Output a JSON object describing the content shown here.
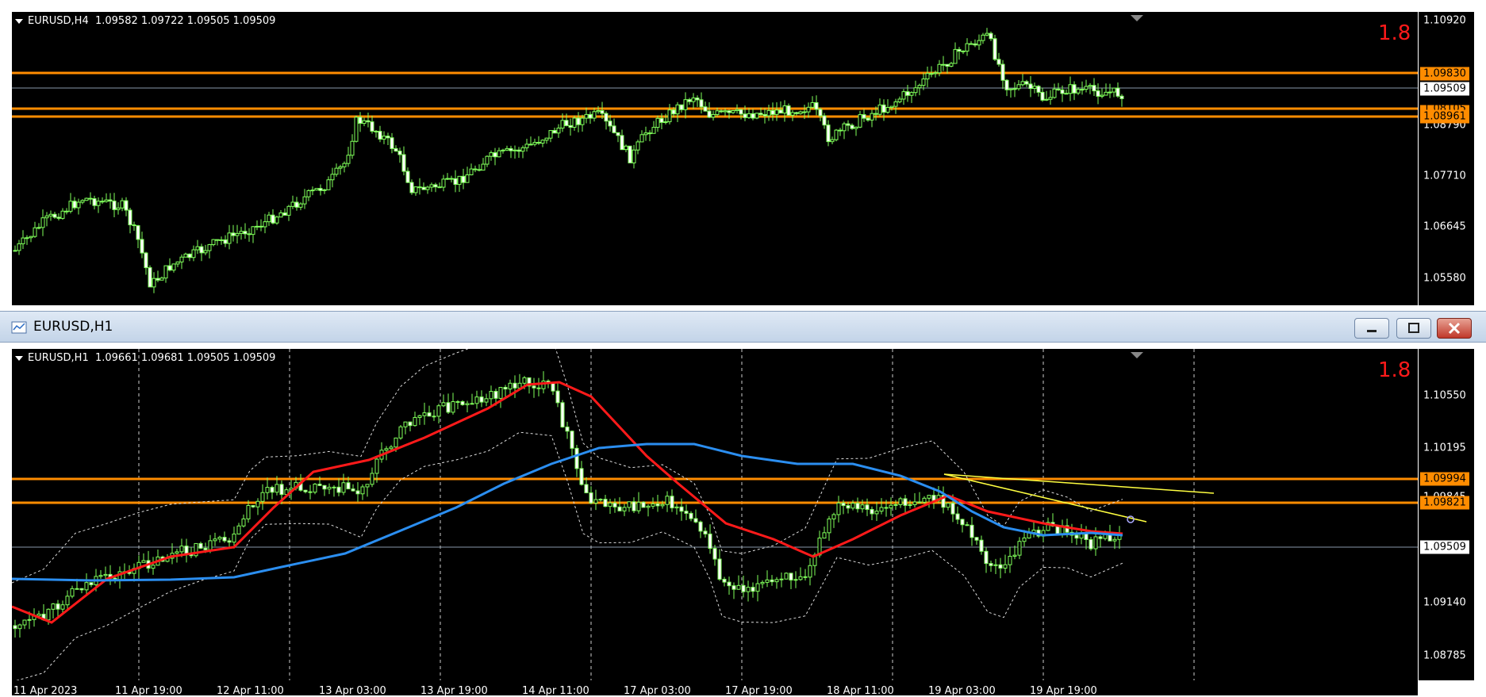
{
  "top_chart": {
    "info_text": "EURUSD,H4  1.09582 1.09722 1.09505 1.09509",
    "indicator_value": "1.8",
    "price_labels": [
      "1.10920",
      "1.08790",
      "1.07710",
      "1.06645",
      "1.05580"
    ],
    "badges": [
      {
        "text": "1.09830",
        "style": "orange"
      },
      {
        "text": "1.09509",
        "style": "white"
      },
      {
        "text": "1.08105",
        "style": "orange"
      },
      {
        "text": "1.08961",
        "style": "orange"
      }
    ]
  },
  "bottom_window": {
    "title": "EURUSD,H1",
    "info_text": "EURUSD,H1  1.09661 1.09681 1.09505 1.09509",
    "indicator_value": "1.8",
    "price_labels": [
      "1.10550",
      "1.10195",
      "1.09845",
      "1.09140",
      "1.08785"
    ],
    "badges": [
      {
        "text": "1.09994",
        "style": "orange"
      },
      {
        "text": "1.09821",
        "style": "orange"
      },
      {
        "text": "1.09509",
        "style": "white"
      }
    ],
    "time_labels": [
      "11 Apr 2023",
      "11 Apr 19:00",
      "12 Apr 11:00",
      "13 Apr 03:00",
      "13 Apr 19:00",
      "14 Apr 11:00",
      "17 Apr 03:00",
      "17 Apr 19:00",
      "18 Apr 11:00",
      "19 Apr 03:00",
      "19 Apr 19:00"
    ]
  },
  "colors": {
    "accent_level": "#ff8c00",
    "ma_red": "#ff1a1a",
    "ma_blue": "#2b8ef0",
    "candle": "#7fff5a",
    "trend": "#ffff40"
  }
}
